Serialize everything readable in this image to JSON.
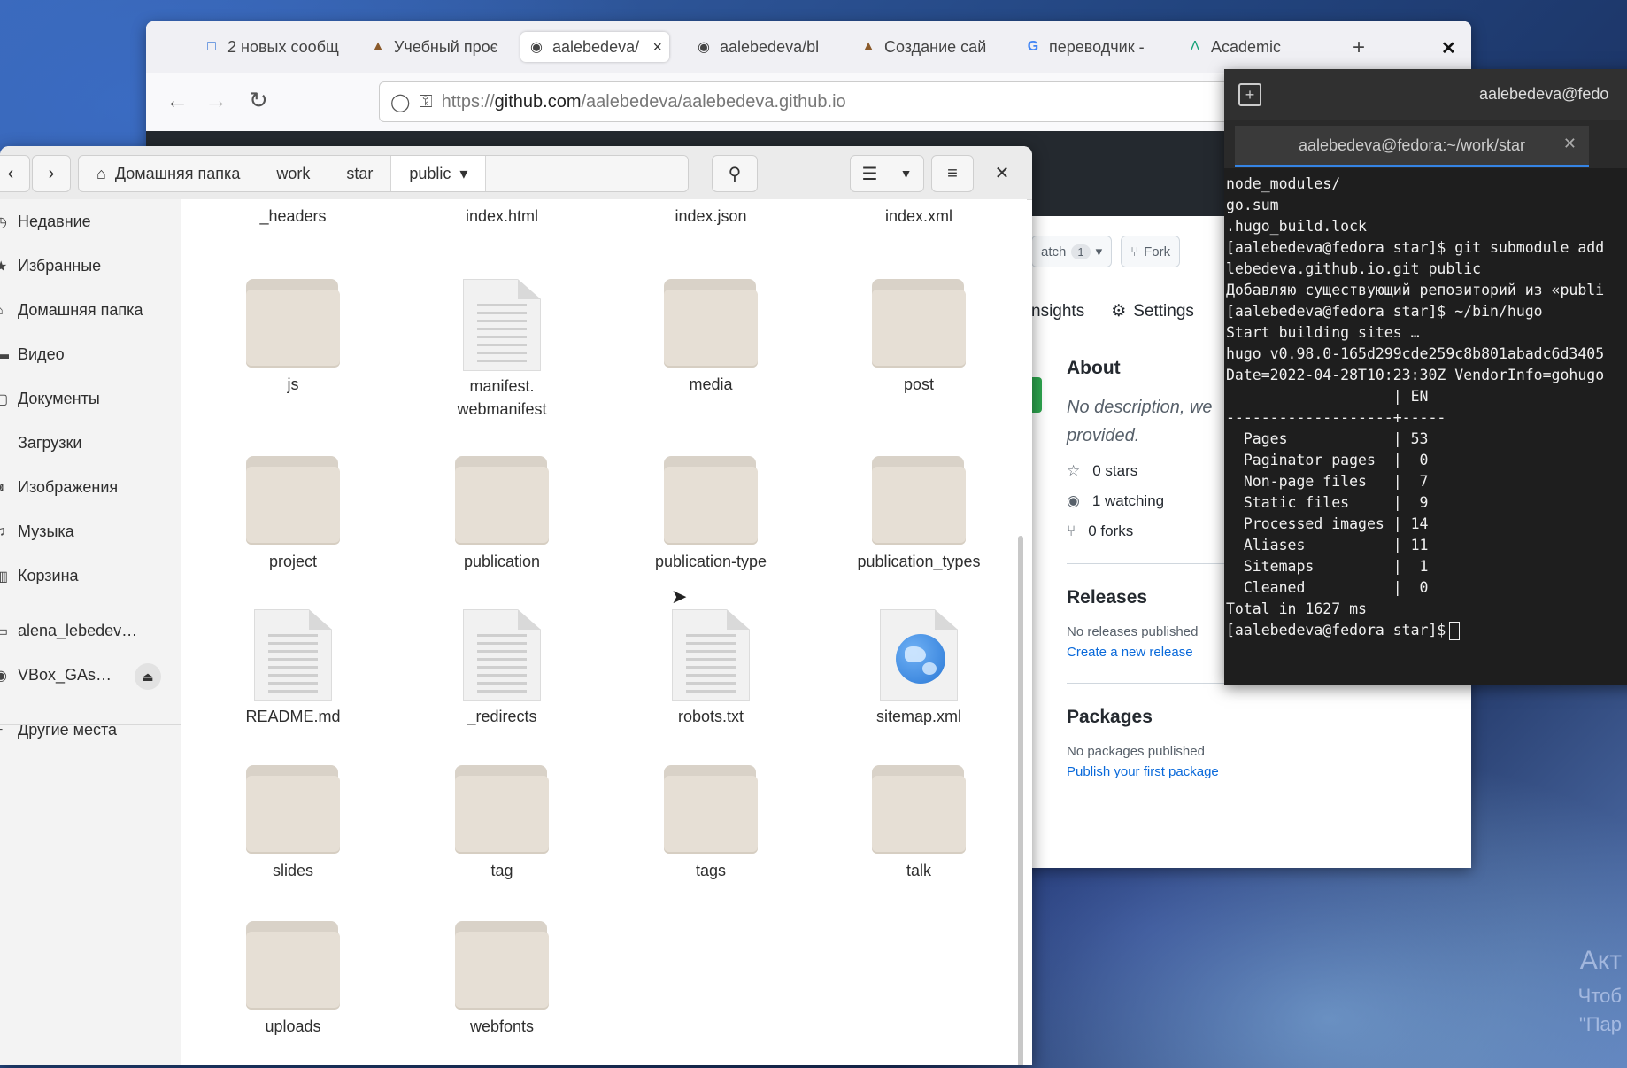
{
  "desktop": {
    "watermark_lines": [
      "Акт",
      "Чтоб",
      "\"Пар"
    ]
  },
  "browser": {
    "tabs": [
      {
        "icon": "chat-icon",
        "label": "2 новых сообщ"
      },
      {
        "icon": "hat-icon",
        "label": "Учебный проє"
      },
      {
        "icon": "github-icon",
        "label": "aalebedeva/a"
      },
      {
        "icon": "github-icon",
        "label": "aalebedeva/bl"
      },
      {
        "icon": "hat-icon",
        "label": "Создание сай"
      },
      {
        "icon": "google-icon",
        "label": "переводчик -"
      },
      {
        "icon": "academic-icon",
        "label": "Academic"
      }
    ],
    "url_scheme": "https://",
    "url_host": "github.com",
    "url_path": "/aalebedeva/aalebedeva.github.io",
    "github": {
      "watch_label": "atch",
      "watch_count": "1",
      "fork_label": "Fork",
      "tab_insights": "nsights",
      "tab_settings": "Settings",
      "about_title": "About",
      "about_desc": "No description, we provided.",
      "stars": "0 stars",
      "watching": "1 watching",
      "forks": "0 forks",
      "releases_title": "Releases",
      "releases_none": "No releases published",
      "releases_link": "Create a new release",
      "packages_title": "Packages",
      "packages_none": "No packages published",
      "packages_link": "Publish your first package"
    }
  },
  "terminal": {
    "title": "aalebedeva@fedo",
    "tab_label": "aalebedeva@fedora:~/work/star",
    "lines": [
      "node_modules/",
      "go.sum",
      ".hugo_build.lock",
      "[aalebedeva@fedora star]$ git submodule add",
      "lebedeva.github.io.git public",
      "Добавляю существующий репозиторий из «publi",
      "[aalebedeva@fedora star]$ ~/bin/hugo",
      "Start building sites …",
      "hugo v0.98.0-165d299cde259c8b801abadc6d3405",
      "Date=2022-04-28T10:23:30Z VendorInfo=gohugo",
      "",
      "                   | EN",
      "-------------------+-----",
      "  Pages            | 53",
      "  Paginator pages  |  0",
      "  Non-page files   |  7",
      "  Static files     |  9",
      "  Processed images | 14",
      "  Aliases          | 11",
      "  Sitemaps         |  1",
      "  Cleaned          |  0",
      "",
      "Total in 1627 ms",
      "[aalebedeva@fedora star]$"
    ]
  },
  "files": {
    "breadcrumbs": [
      "Домашняя папка",
      "work",
      "star",
      "public"
    ],
    "sidebar": [
      {
        "icon": "clock-icon",
        "label": "Недавние"
      },
      {
        "icon": "star-icon",
        "label": "Избранные"
      },
      {
        "icon": "home-icon",
        "label": "Домашняя папка"
      },
      {
        "icon": "video-icon",
        "label": "Видео"
      },
      {
        "icon": "document-icon",
        "label": "Документы"
      },
      {
        "icon": "download-icon",
        "label": "Загрузки"
      },
      {
        "icon": "camera-icon",
        "label": "Изображения"
      },
      {
        "icon": "music-icon",
        "label": "Музыка"
      },
      {
        "icon": "trash-icon",
        "label": "Корзина"
      },
      {
        "icon": "drive-icon",
        "label": "alena_lebedev…"
      },
      {
        "icon": "disc-icon",
        "label": "VBox_GAs…"
      },
      {
        "icon": "plus-icon",
        "label": "Другие места"
      }
    ],
    "items": [
      {
        "type": "folder",
        "label": "_headers"
      },
      {
        "type": "web",
        "label": "index.html"
      },
      {
        "type": "web",
        "label": "index.json"
      },
      {
        "type": "web",
        "label": "index.xml"
      },
      {
        "type": "folder",
        "label": "js"
      },
      {
        "type": "text",
        "label": "manifest.\nwebmanifest"
      },
      {
        "type": "folder",
        "label": "media"
      },
      {
        "type": "folder",
        "label": "post"
      },
      {
        "type": "folder",
        "label": "project"
      },
      {
        "type": "folder",
        "label": "publication"
      },
      {
        "type": "folder",
        "label": "publication-type"
      },
      {
        "type": "folder",
        "label": "publication_types"
      },
      {
        "type": "text",
        "label": "README.md"
      },
      {
        "type": "text",
        "label": "_redirects"
      },
      {
        "type": "text",
        "label": "robots.txt"
      },
      {
        "type": "web",
        "label": "sitemap.xml"
      },
      {
        "type": "folder",
        "label": "slides"
      },
      {
        "type": "folder",
        "label": "tag"
      },
      {
        "type": "folder",
        "label": "tags"
      },
      {
        "type": "folder",
        "label": "talk"
      },
      {
        "type": "folder",
        "label": "uploads"
      },
      {
        "type": "folder",
        "label": "webfonts"
      }
    ]
  }
}
